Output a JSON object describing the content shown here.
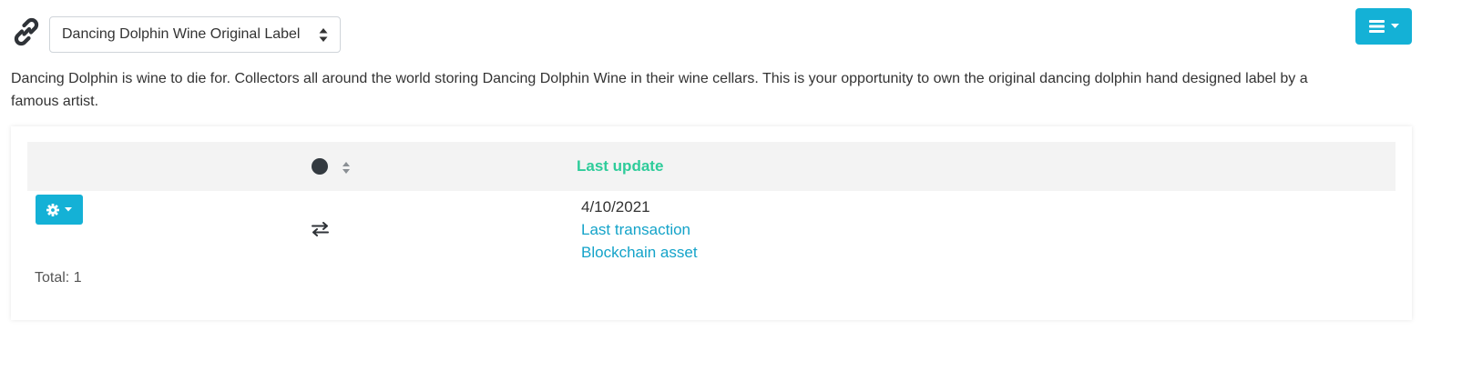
{
  "header": {
    "link_icon": "link-icon",
    "asset_select": {
      "value": "Dancing Dolphin Wine Original Label",
      "caret_icon": "sort-caret-icon"
    },
    "menu_button": {
      "icon": "hamburger-icon",
      "caret_icon": "caret-down-icon",
      "color": "#14b1d6"
    }
  },
  "description": "Dancing Dolphin is wine to die for. Collectors all around the world storing Dancing Dolphin Wine in their wine cellars. This is your opportunity to own the original dancing dolphin hand designed label by a famous artist.",
  "table": {
    "columns": [
      {
        "label": "",
        "key": "actions"
      },
      {
        "label": "",
        "key": "status",
        "icon": "status-dot-icon",
        "sort_icon": "sort-icon"
      },
      {
        "label": "Last update",
        "key": "last_update",
        "color": "#2ecc9a"
      }
    ],
    "rows": [
      {
        "actions_icon": "gear-icon",
        "status_icon": "transfer-icon",
        "last_update": "4/10/2021",
        "links": [
          "Last transaction",
          "Blockchain asset"
        ]
      }
    ],
    "total": "Total: 1"
  },
  "colors": {
    "accent": "#14b1d6",
    "link": "#14a3c9",
    "header_text": "#2ecc9a"
  }
}
